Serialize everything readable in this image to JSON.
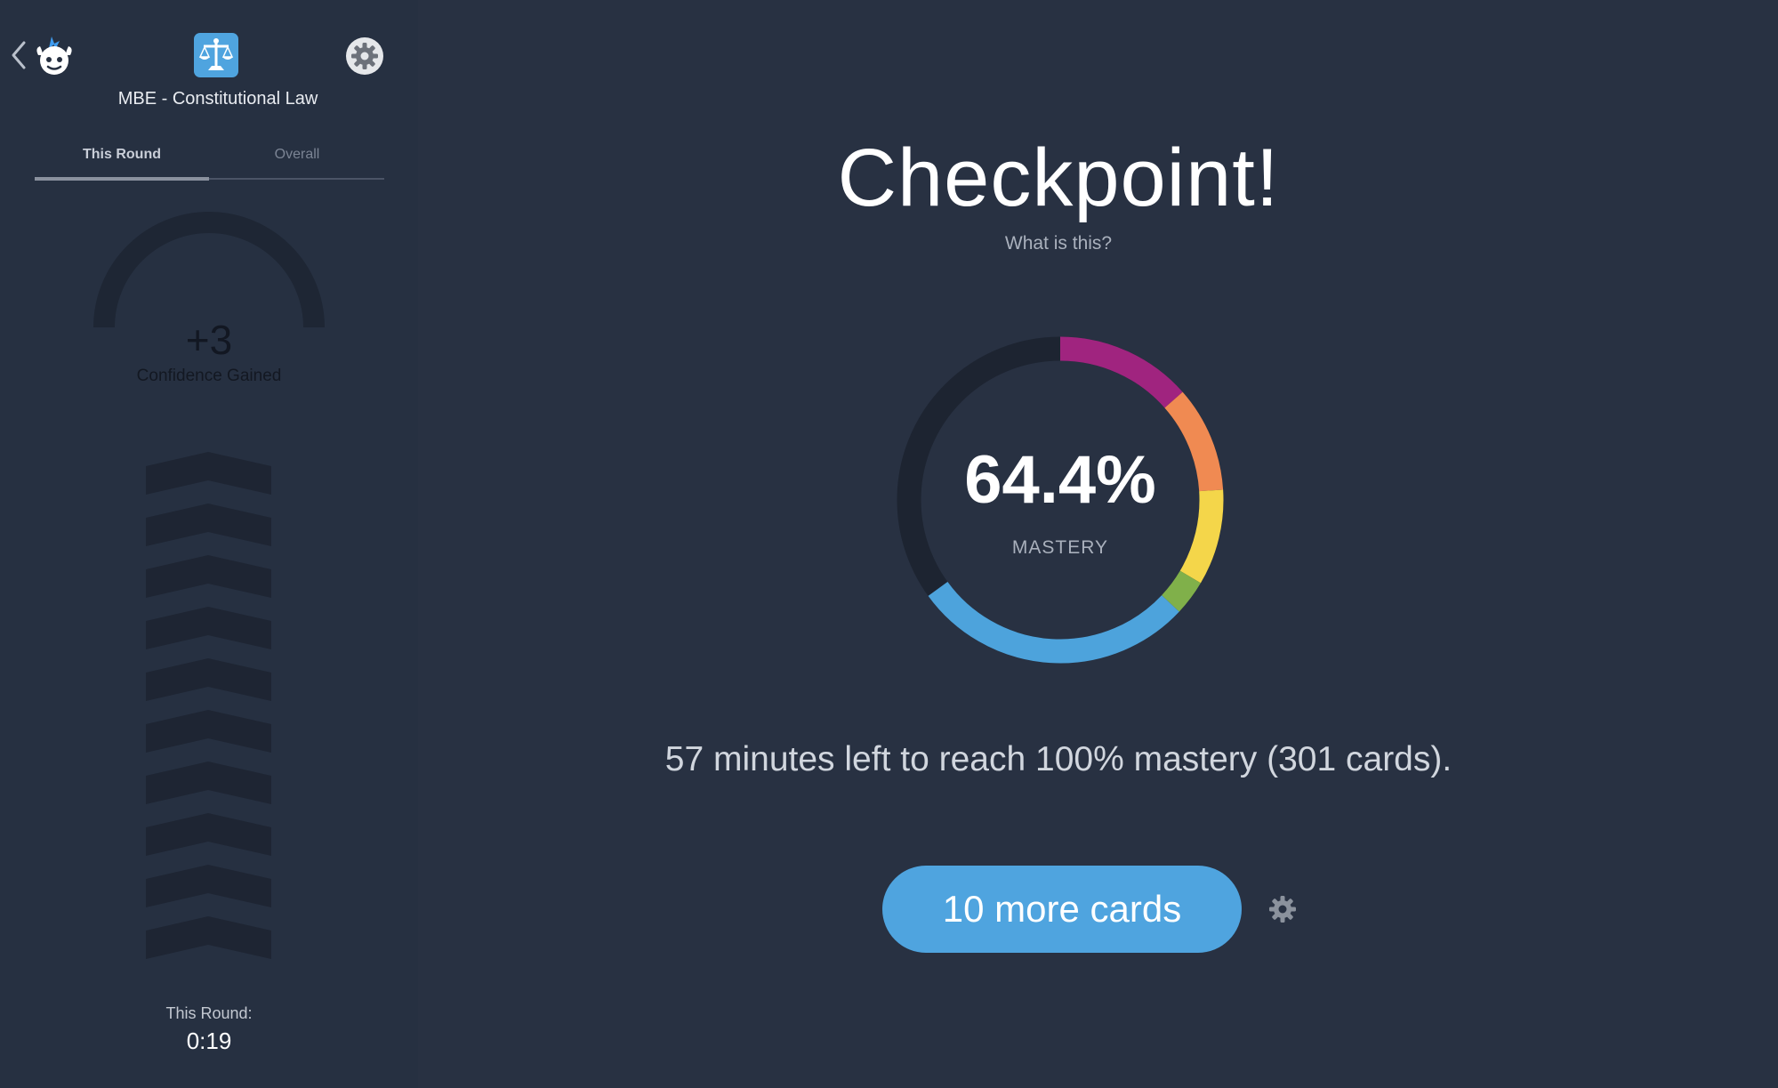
{
  "sidebar": {
    "deck_title": "MBE - Constitutional Law",
    "icons": {
      "back": "chevron-left-icon",
      "logo": "brainscape-logo",
      "deck": "scales-of-justice-icon",
      "settings": "gear-icon"
    },
    "tabs": [
      {
        "label": "This Round",
        "active": true
      },
      {
        "label": "Overall",
        "active": false
      }
    ],
    "gauge": {
      "value": "+3",
      "label": "Confidence Gained"
    },
    "chevron_count": 10,
    "round_label": "This Round:",
    "round_time": "0:19"
  },
  "main": {
    "title": "Checkpoint!",
    "what_link": "What is this?",
    "mastery": {
      "value": "64.4%",
      "label": "MASTERY",
      "segments": [
        {
          "fraction": 0.135,
          "color": "#a0247f"
        },
        {
          "fraction": 0.105,
          "color": "#f08a52"
        },
        {
          "fraction": 0.095,
          "color": "#f4d64a"
        },
        {
          "fraction": 0.035,
          "color": "#80b04a"
        },
        {
          "fraction": 0.28,
          "color": "#4da3dc"
        }
      ],
      "track_color": "#1d2431"
    },
    "summary": "57 minutes left to reach 100% mastery (301 cards).",
    "primary_button": "10 more cards",
    "settings_icon": "gear-icon"
  },
  "colors": {
    "background": "#283142",
    "accent": "#4fa4df"
  }
}
